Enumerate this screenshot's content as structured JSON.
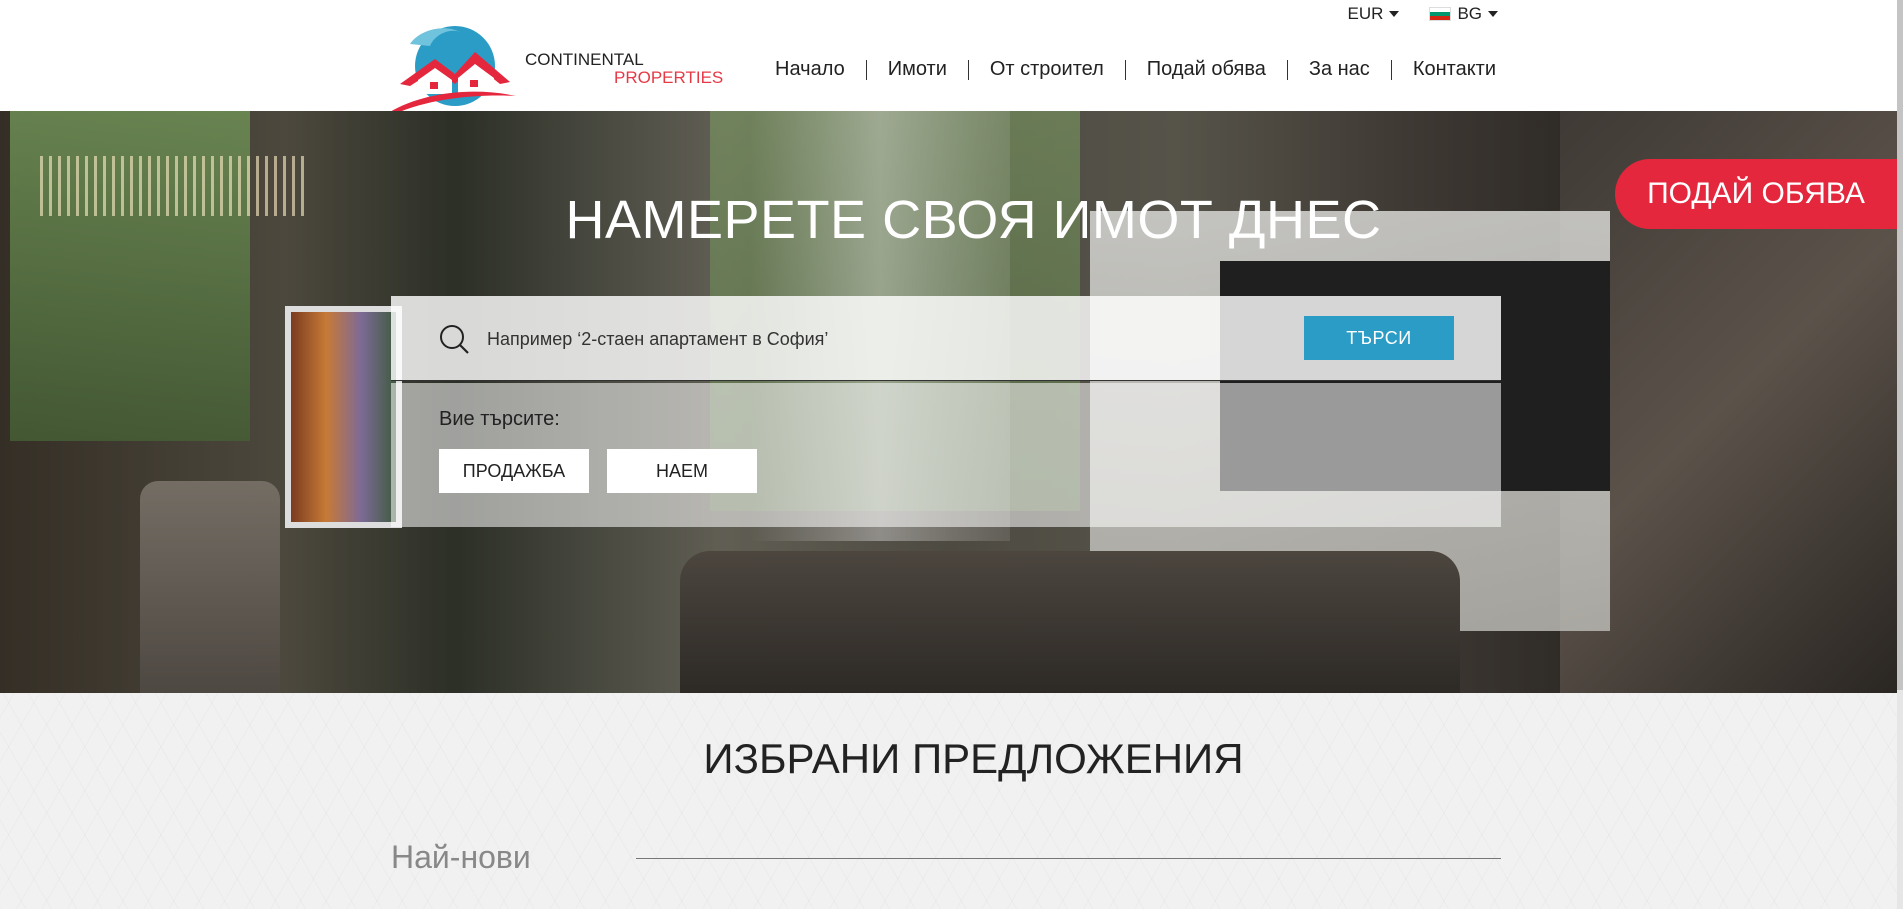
{
  "header": {
    "currency": "EUR",
    "language": "BG",
    "logo": {
      "line1": "CONTINENTAL",
      "line2": "PROPERTIES"
    },
    "nav": [
      "Начало",
      "Имоти",
      "От строител",
      "Подай обява",
      "За нас",
      "Контакти"
    ]
  },
  "hero": {
    "title": "НАМЕРЕТЕ СВОЯ ИМОТ ДНЕС",
    "post_button": "ПОДАЙ ОБЯВА",
    "search": {
      "placeholder": "Например ‘2-стаен апартамент в София’",
      "button": "ТЪРСИ",
      "filter_label": "Вие търсите:",
      "filters": [
        "ПРОДАЖБА",
        "НАЕМ"
      ]
    }
  },
  "featured": {
    "title": "ИЗБРАНИ ПРЕДЛОЖЕНИЯ",
    "newest": "Най-нови"
  },
  "colors": {
    "accent_red": "#e4273d",
    "accent_blue": "#2a9cc5"
  }
}
